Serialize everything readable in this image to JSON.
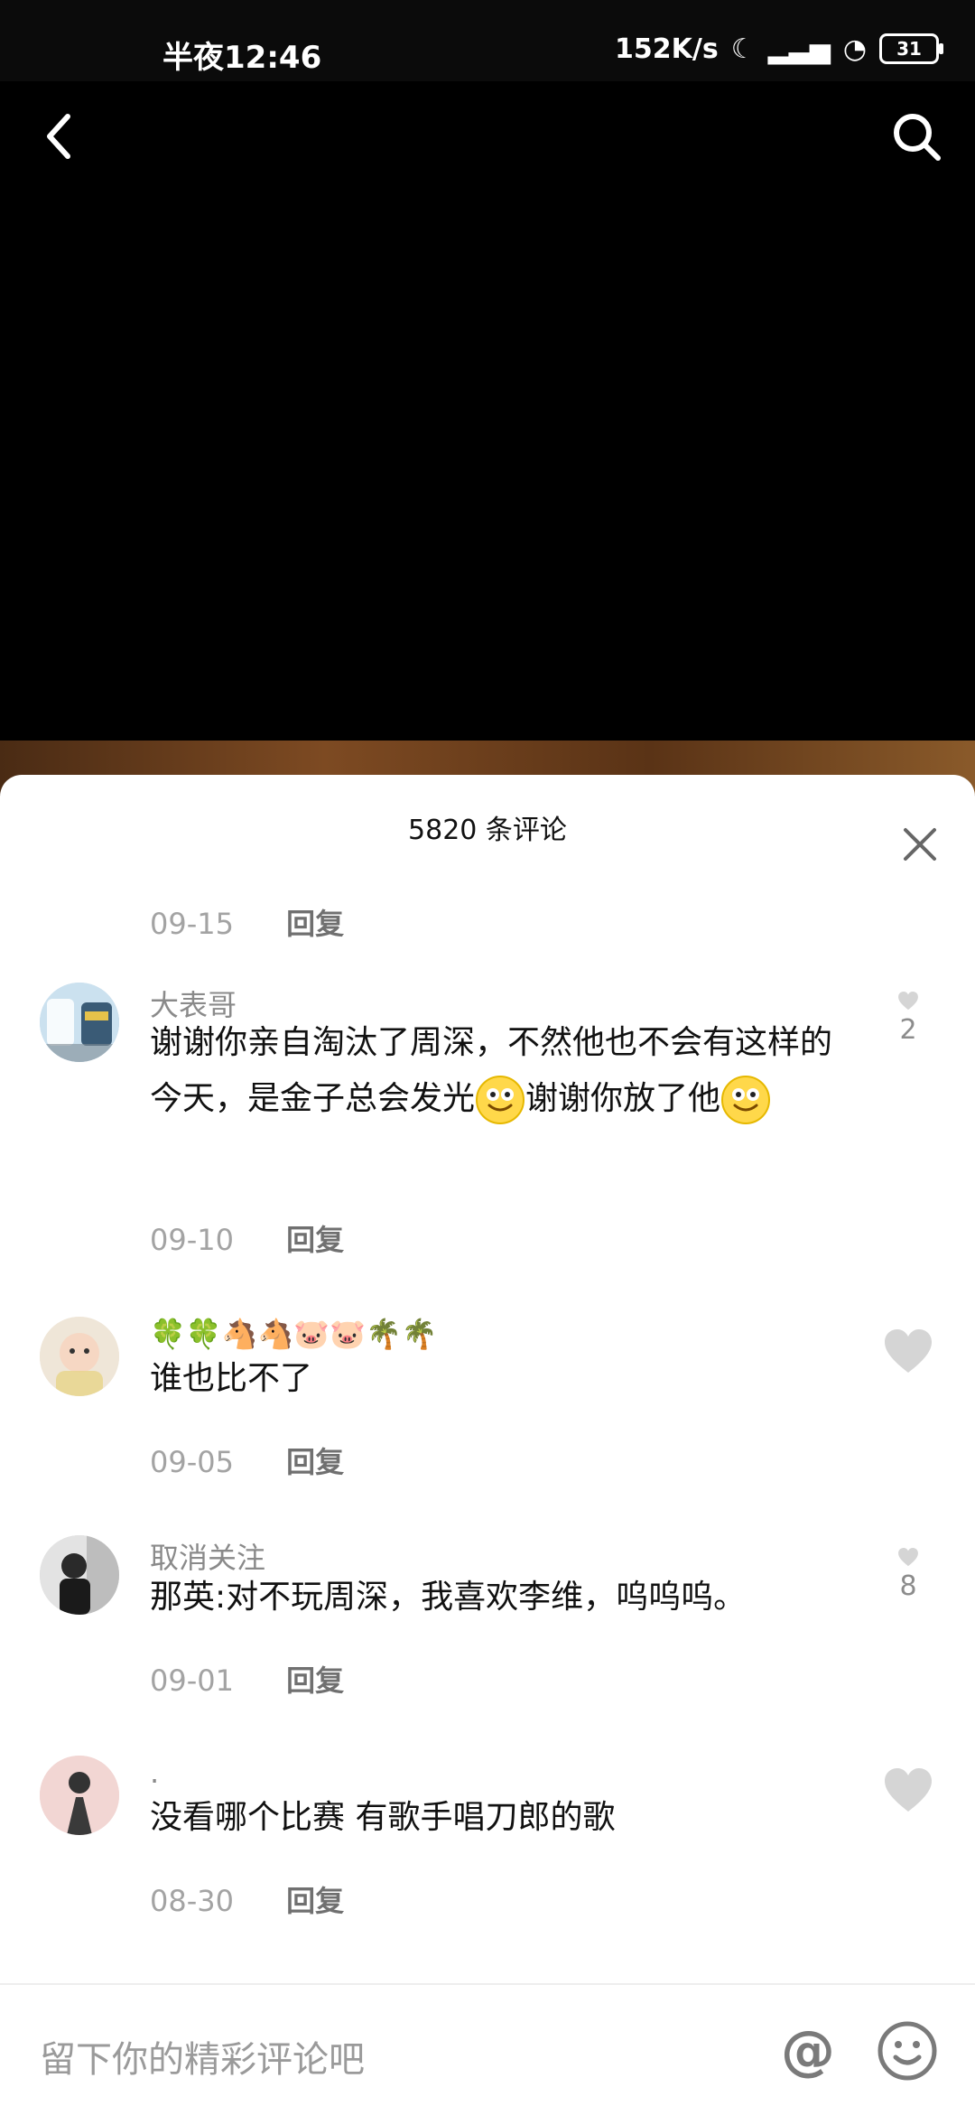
{
  "status": {
    "time": "半夜12:46",
    "speed": "152K/s",
    "battery": "31"
  },
  "comments_header": {
    "title": "5820 条评论"
  },
  "comments": [
    {
      "username": "",
      "text": "",
      "date": "09-15",
      "reply": "回复",
      "likes": ""
    },
    {
      "username": "大表哥",
      "text_parts": [
        "谢谢你亲自淘汰了周深，不然他也不会有这样的今天，是金子总会发光",
        "谢谢你放了他"
      ],
      "date": "09-10",
      "reply": "回复",
      "likes": "2"
    },
    {
      "username": "🍀🍀🐴🐴🐷🐷🌴🌴",
      "text": "谁也比不了",
      "date": "09-05",
      "reply": "回复",
      "likes": ""
    },
    {
      "username": "取消关注",
      "text": "那英:对不玩周深，我喜欢李维，呜呜呜。",
      "date": "09-01",
      "reply": "回复",
      "likes": "8"
    },
    {
      "username": ".",
      "text": "没看哪个比赛 有歌手唱刀郎的歌",
      "date": "08-30",
      "reply": "回复",
      "likes": ""
    }
  ],
  "input": {
    "placeholder": "留下你的精彩评论吧"
  },
  "icons": {
    "back": "back-icon",
    "search": "search-icon",
    "close": "close-icon",
    "like": "heart-icon",
    "at": "at-icon",
    "emoji": "emoji-icon"
  }
}
